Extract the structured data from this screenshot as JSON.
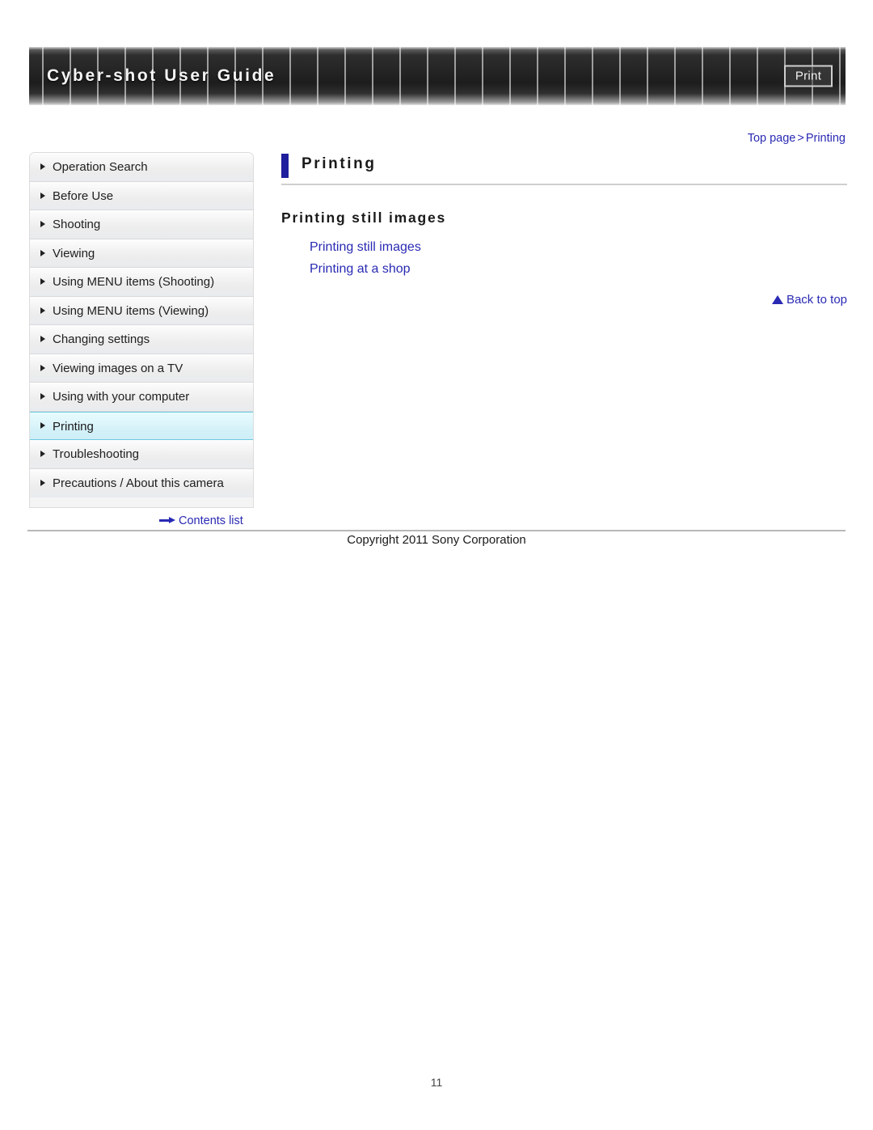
{
  "header": {
    "title": "Cyber-shot User Guide",
    "print_label": "Print"
  },
  "breadcrumb": {
    "top_page": "Top page",
    "separator": ">",
    "current": "Printing"
  },
  "sidebar": {
    "items": [
      {
        "label": "Operation Search",
        "active": false
      },
      {
        "label": "Before Use",
        "active": false
      },
      {
        "label": "Shooting",
        "active": false
      },
      {
        "label": "Viewing",
        "active": false
      },
      {
        "label": "Using MENU items (Shooting)",
        "active": false
      },
      {
        "label": "Using MENU items (Viewing)",
        "active": false
      },
      {
        "label": "Changing settings",
        "active": false
      },
      {
        "label": "Viewing images on a TV",
        "active": false
      },
      {
        "label": "Using with your computer",
        "active": false
      },
      {
        "label": "Printing",
        "active": true
      },
      {
        "label": "Troubleshooting",
        "active": false
      },
      {
        "label": "Precautions / About this camera",
        "active": false
      }
    ],
    "contents_list_label": "Contents list"
  },
  "main": {
    "page_heading": "Printing",
    "section_heading": "Printing still images",
    "links": [
      "Printing still images",
      "Printing at a shop"
    ],
    "back_to_top_label": "Back to top"
  },
  "footer": {
    "copyright": "Copyright 2011 Sony Corporation",
    "page_number": "11"
  },
  "colors": {
    "link_blue": "#2a2ab4",
    "heading_bar_navy": "#1f1f9e",
    "active_nav_border": "#6cc9e0",
    "banner_dark": "#2b2b2b"
  }
}
